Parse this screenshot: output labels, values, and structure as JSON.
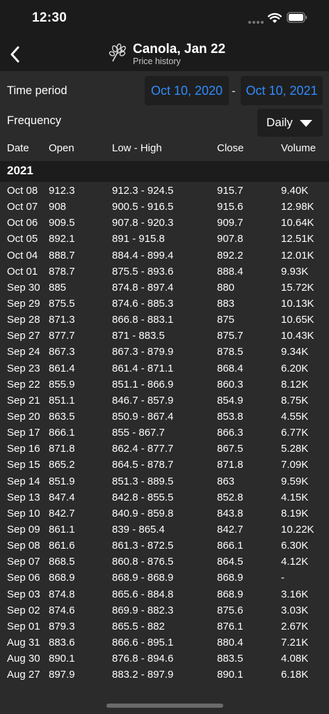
{
  "status": {
    "time": "12:30"
  },
  "nav": {
    "title": "Canola, Jan 22",
    "subtitle": "Price history"
  },
  "controls": {
    "time_period_label": "Time period",
    "start_date": "Oct 10, 2020",
    "separator": "-",
    "end_date": "Oct 10, 2021",
    "frequency_label": "Frequency",
    "frequency_value": "Daily"
  },
  "columns": {
    "date": "Date",
    "open": "Open",
    "range": "Low - High",
    "close": "Close",
    "volume": "Volume"
  },
  "section": {
    "year": "2021"
  },
  "rows": [
    {
      "date": "Oct 08",
      "open": "912.3",
      "range": "912.3 - 924.5",
      "close": "915.7",
      "volume": "9.40K"
    },
    {
      "date": "Oct 07",
      "open": "908",
      "range": "900.5 - 916.5",
      "close": "915.6",
      "volume": "12.98K"
    },
    {
      "date": "Oct 06",
      "open": "909.5",
      "range": "907.8 - 920.3",
      "close": "909.7",
      "volume": "10.64K"
    },
    {
      "date": "Oct 05",
      "open": "892.1",
      "range": "891 - 915.8",
      "close": "907.8",
      "volume": "12.51K"
    },
    {
      "date": "Oct 04",
      "open": "888.7",
      "range": "884.4 - 899.4",
      "close": "892.2",
      "volume": "12.01K"
    },
    {
      "date": "Oct 01",
      "open": "878.7",
      "range": "875.5 - 893.6",
      "close": "888.4",
      "volume": "9.93K"
    },
    {
      "date": "Sep 30",
      "open": "885",
      "range": "874.8 - 897.4",
      "close": "880",
      "volume": "15.72K"
    },
    {
      "date": "Sep 29",
      "open": "875.5",
      "range": "874.6 - 885.3",
      "close": "883",
      "volume": "10.13K"
    },
    {
      "date": "Sep 28",
      "open": "871.3",
      "range": "866.8 - 883.1",
      "close": "875",
      "volume": "10.65K"
    },
    {
      "date": "Sep 27",
      "open": "877.7",
      "range": "871 - 883.5",
      "close": "875.7",
      "volume": "10.43K"
    },
    {
      "date": "Sep 24",
      "open": "867.3",
      "range": "867.3 - 879.9",
      "close": "878.5",
      "volume": "9.34K"
    },
    {
      "date": "Sep 23",
      "open": "861.4",
      "range": "861.4 - 871.1",
      "close": "868.4",
      "volume": "6.20K"
    },
    {
      "date": "Sep 22",
      "open": "855.9",
      "range": "851.1 - 866.9",
      "close": "860.3",
      "volume": "8.12K"
    },
    {
      "date": "Sep 21",
      "open": "851.1",
      "range": "846.7 - 857.9",
      "close": "854.9",
      "volume": "8.75K"
    },
    {
      "date": "Sep 20",
      "open": "863.5",
      "range": "850.9 - 867.4",
      "close": "853.8",
      "volume": "4.55K"
    },
    {
      "date": "Sep 17",
      "open": "866.1",
      "range": "855 - 867.7",
      "close": "866.3",
      "volume": "6.77K"
    },
    {
      "date": "Sep 16",
      "open": "871.8",
      "range": "862.4 - 877.7",
      "close": "867.5",
      "volume": "5.28K"
    },
    {
      "date": "Sep 15",
      "open": "865.2",
      "range": "864.5 - 878.7",
      "close": "871.8",
      "volume": "7.09K"
    },
    {
      "date": "Sep 14",
      "open": "851.9",
      "range": "851.3 - 889.5",
      "close": "863",
      "volume": "9.59K"
    },
    {
      "date": "Sep 13",
      "open": "847.4",
      "range": "842.8 - 855.5",
      "close": "852.8",
      "volume": "4.15K"
    },
    {
      "date": "Sep 10",
      "open": "842.7",
      "range": "840.9 - 859.8",
      "close": "843.8",
      "volume": "8.19K"
    },
    {
      "date": "Sep 09",
      "open": "861.1",
      "range": "839 - 865.4",
      "close": "842.7",
      "volume": "10.22K"
    },
    {
      "date": "Sep 08",
      "open": "861.6",
      "range": "861.3 - 872.5",
      "close": "866.1",
      "volume": "6.30K"
    },
    {
      "date": "Sep 07",
      "open": "868.5",
      "range": "860.8 - 876.5",
      "close": "864.5",
      "volume": "4.12K"
    },
    {
      "date": "Sep 06",
      "open": "868.9",
      "range": "868.9 - 868.9",
      "close": "868.9",
      "volume": "-"
    },
    {
      "date": "Sep 03",
      "open": "874.8",
      "range": "865.6 - 884.8",
      "close": "868.9",
      "volume": "3.16K"
    },
    {
      "date": "Sep 02",
      "open": "874.6",
      "range": "869.9 - 882.3",
      "close": "875.6",
      "volume": "3.03K"
    },
    {
      "date": "Sep 01",
      "open": "879.3",
      "range": "865.5 - 882",
      "close": "876.1",
      "volume": "2.67K"
    },
    {
      "date": "Aug 31",
      "open": "883.6",
      "range": "866.6 - 895.1",
      "close": "880.4",
      "volume": "7.21K"
    },
    {
      "date": "Aug 30",
      "open": "890.1",
      "range": "876.8 - 894.6",
      "close": "883.5",
      "volume": "4.08K"
    },
    {
      "date": "Aug 27",
      "open": "897.9",
      "range": "883.2 - 897.9",
      "close": "890.1",
      "volume": "6.18K"
    }
  ],
  "colors": {
    "accent": "#2f8cff",
    "background": "#2b2b2b",
    "bar": "#1b1b1b"
  }
}
